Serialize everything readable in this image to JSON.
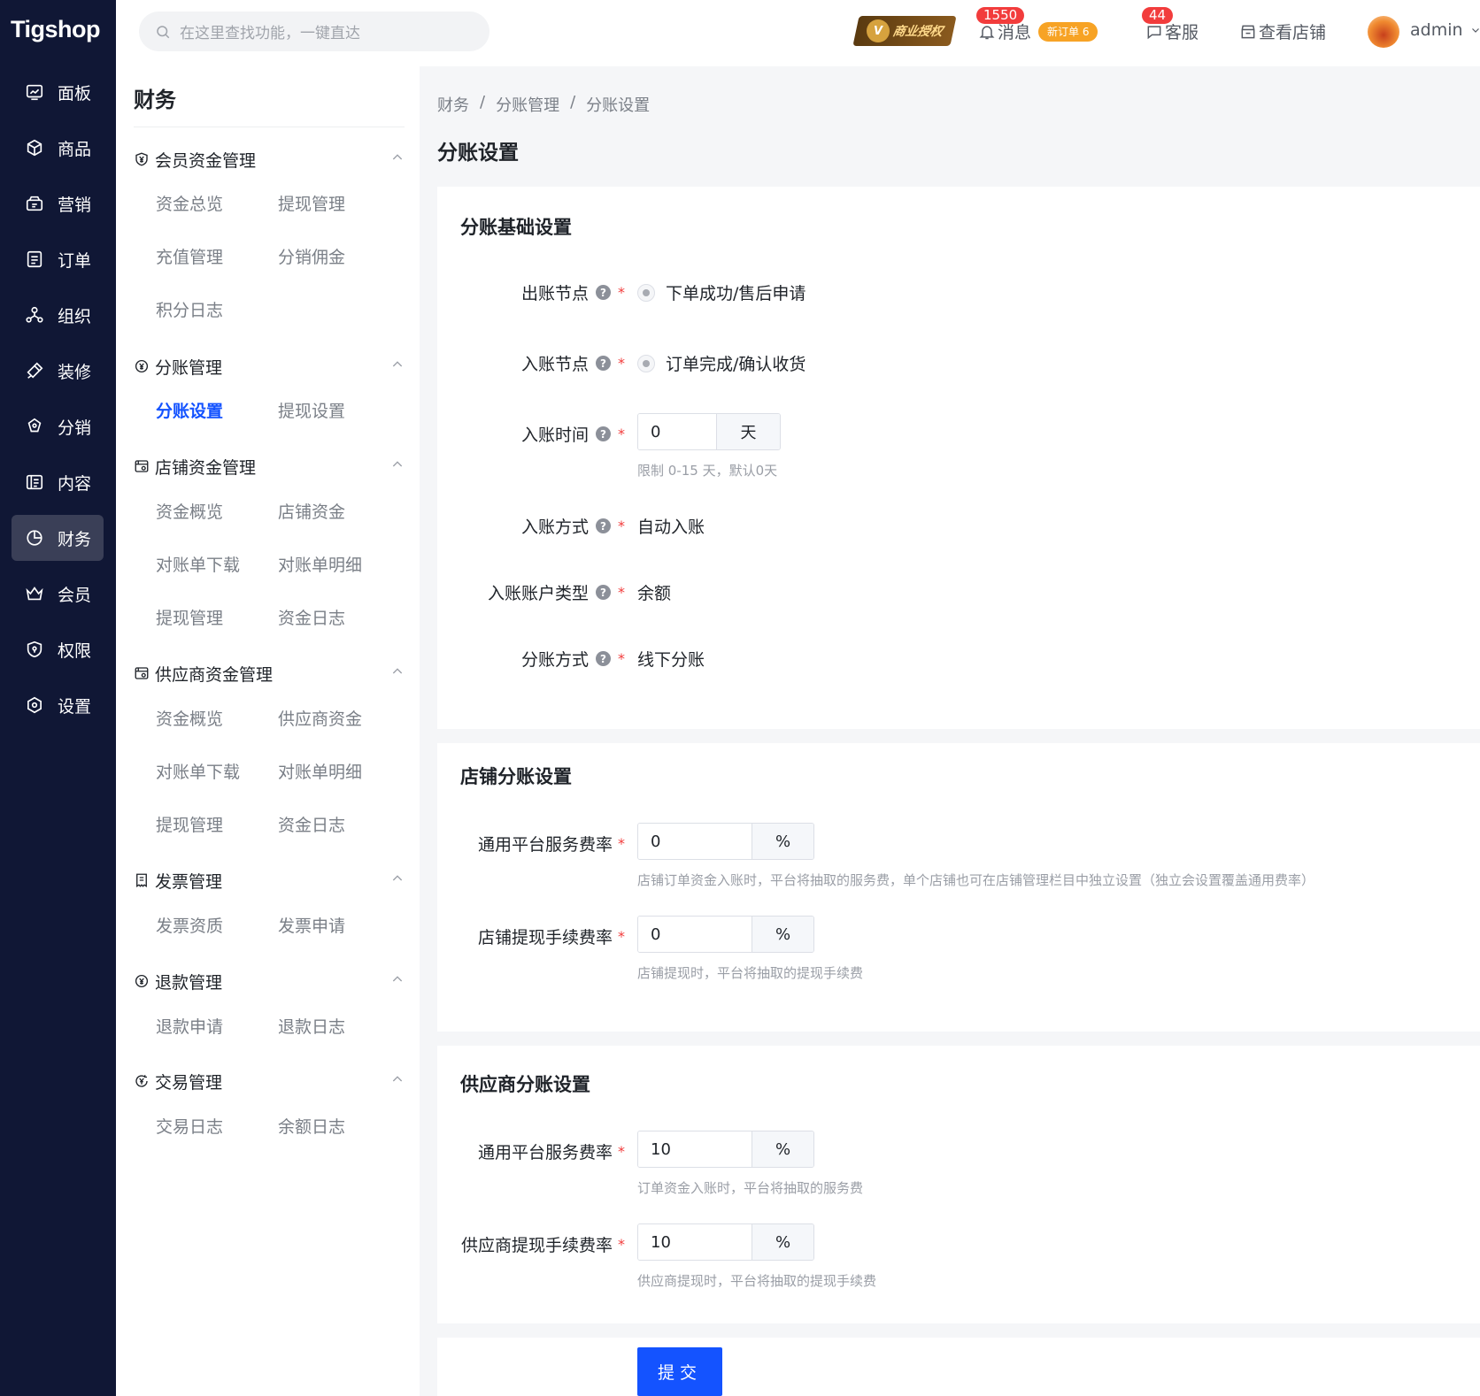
{
  "brand": {
    "logo_text": "Tigshop"
  },
  "nav": {
    "items": [
      {
        "label": "面板",
        "icon": "dashboard-icon"
      },
      {
        "label": "商品",
        "icon": "box-icon"
      },
      {
        "label": "营销",
        "icon": "marketing-icon"
      },
      {
        "label": "订单",
        "icon": "order-icon"
      },
      {
        "label": "组织",
        "icon": "org-icon"
      },
      {
        "label": "装修",
        "icon": "brush-icon"
      },
      {
        "label": "分销",
        "icon": "distribution-icon"
      },
      {
        "label": "内容",
        "icon": "content-icon"
      },
      {
        "label": "财务",
        "icon": "finance-icon",
        "active": true
      },
      {
        "label": "会员",
        "icon": "crown-icon"
      },
      {
        "label": "权限",
        "icon": "shield-icon"
      },
      {
        "label": "设置",
        "icon": "gear-icon"
      }
    ]
  },
  "header": {
    "search_placeholder": "在这里查找功能，一键直达",
    "auth_label": "商业授权",
    "messages": {
      "label": "消息",
      "count": "1550",
      "new_orders": "新订单 6"
    },
    "service": {
      "label": "客服",
      "count": "44"
    },
    "view_store": "查看店铺",
    "user": "admin"
  },
  "sidebar": {
    "title": "财务",
    "groups": [
      {
        "label": "会员资金管理",
        "items": [
          "资金总览",
          "提现管理",
          "充值管理",
          "分销佣金",
          "积分日志"
        ]
      },
      {
        "label": "分账管理",
        "items": [
          "分账设置",
          "提现设置"
        ]
      },
      {
        "label": "店铺资金管理",
        "items": [
          "资金概览",
          "店铺资金",
          "对账单下载",
          "对账单明细",
          "提现管理",
          "资金日志"
        ]
      },
      {
        "label": "供应商资金管理",
        "items": [
          "资金概览",
          "供应商资金",
          "对账单下载",
          "对账单明细",
          "提现管理",
          "资金日志"
        ]
      },
      {
        "label": "发票管理",
        "items": [
          "发票资质",
          "发票申请"
        ]
      },
      {
        "label": "退款管理",
        "items": [
          "退款申请",
          "退款日志"
        ]
      },
      {
        "label": "交易管理",
        "items": [
          "交易日志",
          "余额日志"
        ]
      }
    ]
  },
  "breadcrumb": [
    "财务",
    "分账管理",
    "分账设置"
  ],
  "page_title": "分账设置",
  "basic": {
    "title": "分账基础设置",
    "out_node": {
      "label": "出账节点",
      "value": "下单成功/售后申请"
    },
    "in_node": {
      "label": "入账节点",
      "value": "订单完成/确认收货"
    },
    "in_time": {
      "label": "入账时间",
      "value": "0",
      "unit": "天",
      "hint": "限制 0-15 天，默认0天"
    },
    "in_method": {
      "label": "入账方式",
      "value": "自动入账"
    },
    "in_account": {
      "label": "入账账户类型",
      "value": "余额"
    },
    "split_method": {
      "label": "分账方式",
      "value": "线下分账"
    }
  },
  "shop": {
    "title": "店铺分账设置",
    "service_rate": {
      "label": "通用平台服务费率",
      "value": "0",
      "unit": "%",
      "hint": "店铺订单资金入账时，平台将抽取的服务费，单个店铺也可在店铺管理栏目中独立设置（独立会设置覆盖通用费率）"
    },
    "withdraw_rate": {
      "label": "店铺提现手续费率",
      "value": "0",
      "unit": "%",
      "hint": "店铺提现时，平台将抽取的提现手续费"
    }
  },
  "supplier": {
    "title": "供应商分账设置",
    "service_rate": {
      "label": "通用平台服务费率",
      "value": "10",
      "unit": "%",
      "hint": "订单资金入账时，平台将抽取的服务费"
    },
    "withdraw_rate": {
      "label": "供应商提现手续费率",
      "value": "10",
      "unit": "%",
      "hint": "供应商提现时，平台将抽取的提现手续费"
    }
  },
  "submit_label": "提交",
  "colors": {
    "primary": "#1453ff",
    "nav_bg": "#101735",
    "required": "#f23c3c",
    "badge": "#f23c3c",
    "order_pill": "#f7a325"
  }
}
